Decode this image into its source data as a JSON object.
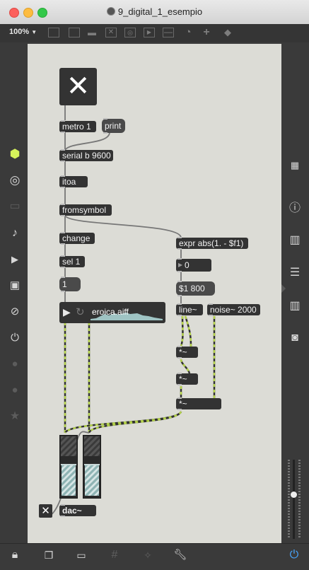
{
  "window": {
    "title": "9_digital_1_esempio"
  },
  "toolbar": {
    "zoom": "100%",
    "zoom_caret": "▼"
  },
  "patch": {
    "toggle_large_glyph": "✕",
    "metro": "metro 1",
    "print": "print",
    "serial": "serial b 9600",
    "itoa": "itoa",
    "fromsymbol": "fromsymbol",
    "change": "change",
    "sel": "sel 1",
    "msg_one": "1",
    "expr": "expr abs(1. - $f1)",
    "number_value": "0",
    "msg_line": "$1 800",
    "line": "line~",
    "noise": "noise~ 2000",
    "mul1": "*~",
    "mul2": "*~",
    "mul3": "*~",
    "sfplay_file": "eroica.aiff",
    "dac": "dac~",
    "toggle_small_glyph": "✕"
  },
  "meter": {
    "left_level": 0.78,
    "right_level": 0.78
  },
  "volume": {
    "level": 0.55
  },
  "colors": {
    "patch_bg": "#dcdcd6",
    "object_bg": "#333333",
    "signal_wire": "#b4d24a",
    "accent_green": "#d6f25b",
    "power_blue": "#48a6ff"
  }
}
